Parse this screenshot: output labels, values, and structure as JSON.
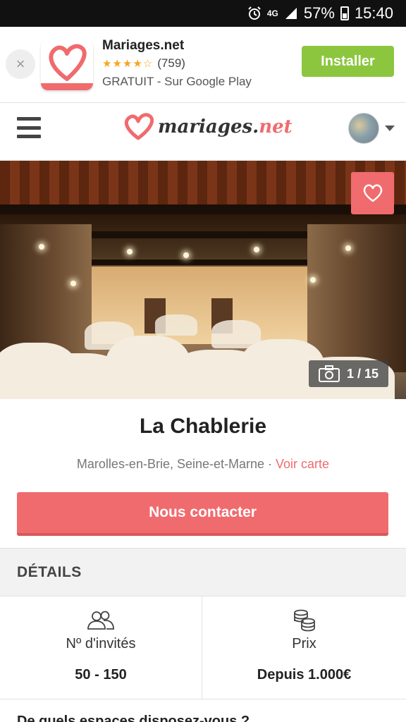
{
  "status_bar": {
    "network": "4G",
    "battery": "57%",
    "time": "15:40"
  },
  "ad": {
    "close": "×",
    "title": "Mariages.net",
    "rating_count": "(759)",
    "subtitle": "GRATUIT - Sur Google Play",
    "install_label": "Installer"
  },
  "header": {
    "brand_main": "mariages.",
    "brand_accent": "net"
  },
  "hero": {
    "photo_counter": "1 / 15"
  },
  "venue": {
    "name": "La Chablerie",
    "location": "Marolles-en-Brie, Seine-et-Marne · ",
    "map_link": "Voir carte",
    "contact_label": "Nous contacter"
  },
  "details": {
    "heading": "DÉTAILS",
    "guests_label": "Nº d'invités",
    "guests_value": "50 - 150",
    "price_label": "Prix",
    "price_value": "Depuis 1.000€"
  },
  "next_question": "De quels espaces disposez-vous ?",
  "colors": {
    "accent": "#f06b6e",
    "install_green": "#8cc63f"
  }
}
